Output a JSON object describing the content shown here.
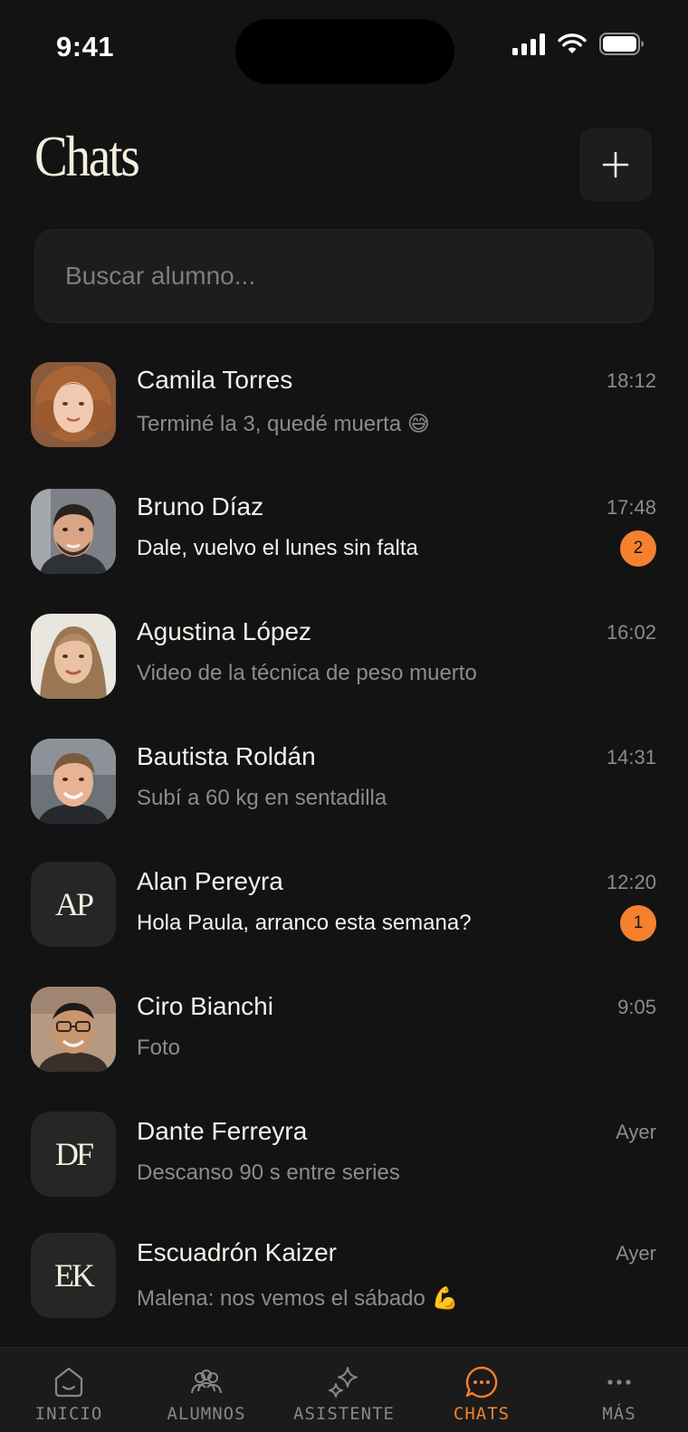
{
  "status_bar": {
    "time": "9:41"
  },
  "header": {
    "title": "Chats",
    "add_icon": "plus-icon"
  },
  "search": {
    "placeholder": "Buscar alumno...",
    "value": ""
  },
  "chats": [
    {
      "name": "Camila Torres",
      "preview": "Terminé la 3, quedé muerta 😅",
      "time": "18:12",
      "unread": "",
      "avatar": "photo"
    },
    {
      "name": "Bruno Díaz",
      "preview": "Dale, vuelvo el lunes sin falta",
      "time": "17:48",
      "unread": "2",
      "avatar": "photo"
    },
    {
      "name": "Agustina López",
      "preview": "Video de la técnica de peso muerto",
      "time": "16:02",
      "unread": "",
      "avatar": "photo"
    },
    {
      "name": "Bautista Roldán",
      "preview": "Subí a 60 kg en sentadilla",
      "time": "14:31",
      "unread": "",
      "avatar": "photo"
    },
    {
      "name": "Alan Pereyra",
      "preview": "Hola Paula, arranco esta semana?",
      "time": "12:20",
      "unread": "1",
      "avatar": "AP"
    },
    {
      "name": "Ciro Bianchi",
      "preview": "Foto",
      "time": "9:05",
      "unread": "",
      "avatar": "photo"
    },
    {
      "name": "Dante Ferreyra",
      "preview": "Descanso 90 s entre series",
      "time": "Ayer",
      "unread": "",
      "avatar": "DF"
    },
    {
      "name": "Escuadrón Kaizer",
      "preview": "Malena: nos vemos el sábado 💪",
      "time": "Ayer",
      "unread": "",
      "avatar": "EK"
    }
  ],
  "tabs": [
    {
      "label": "INICIO",
      "icon": "home-icon",
      "active": false
    },
    {
      "label": "ALUMNOS",
      "icon": "users-icon",
      "active": false
    },
    {
      "label": "ASISTENTE",
      "icon": "sparkle-icon",
      "active": false
    },
    {
      "label": "CHATS",
      "icon": "chat-bubble-icon",
      "active": true
    },
    {
      "label": "MÁS",
      "icon": "more-dots-icon",
      "active": false
    }
  ],
  "colors": {
    "background": "#131313",
    "accent": "#f5812e",
    "surface": "#1d1d1d",
    "muted_text": "#8e8c88"
  }
}
